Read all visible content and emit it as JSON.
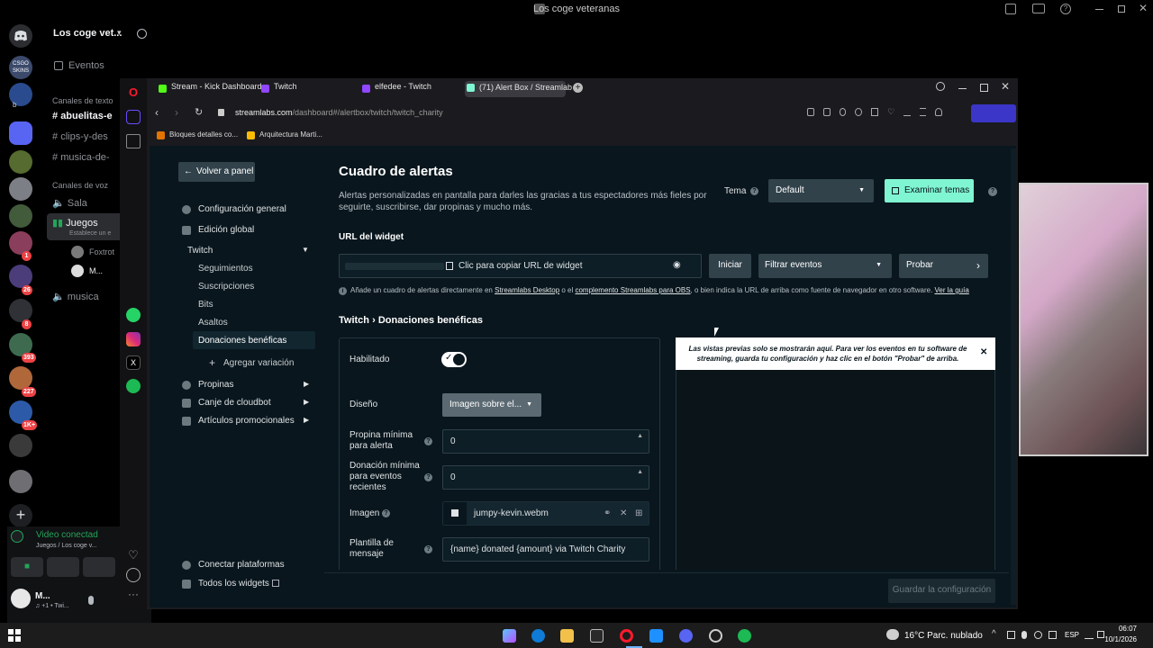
{
  "discord": {
    "window_title": "Los coge veteranas",
    "server_name": "Los coge vet...",
    "events": "Eventos",
    "text_category": "Canales de texto",
    "text_channels": [
      "abuelitas-e",
      "clips-y-des",
      "musica-de-"
    ],
    "voice_category": "Canales de voz",
    "voice_channels": [
      "Sala",
      "Juegos",
      "musica"
    ],
    "juegos_status": "Establece un e",
    "voice_users": [
      "Foxtrot",
      "M..."
    ],
    "server_badges": [
      "1",
      "26",
      "8",
      "393",
      "227",
      "1K+"
    ],
    "server_label_csgo": "CSGO SKINS",
    "server_label_b": "b",
    "voice_connected": "Video conectad",
    "voice_location": "Juegos / Los coge v...",
    "user_name": "M...",
    "user_status": "♫ +1 • Twi..."
  },
  "browser": {
    "tabs": [
      {
        "label": "Stream - Kick Dashboard",
        "color": "#53fc18"
      },
      {
        "label": "Twitch",
        "color": "#9146ff"
      },
      {
        "label": "elfedee - Twitch",
        "color": "#9146ff"
      },
      {
        "label": "(71) Alert Box / Streamlab",
        "color": "#80f5d2"
      }
    ],
    "url_domain": "streamlabs.com",
    "url_path": "/dashboard#/alertbox/twitch/twitch_charity",
    "bookmarks": [
      "Bloques detalles co...",
      "Arquitectura Marti..."
    ]
  },
  "streamlabs": {
    "back_button": "Volver a panel",
    "menu_general": "Configuración general",
    "menu_global": "Edición global",
    "menu_twitch": "Twitch",
    "twitch_items": [
      "Seguimientos",
      "Suscripciones",
      "Bits",
      "Asaltos",
      "Donaciones benéficas"
    ],
    "add_variation": "Agregar variación",
    "menu_tips": "Propinas",
    "menu_cloudbot": "Canje de cloudbot",
    "menu_promo": "Artículos promocionales",
    "connect_platforms": "Conectar plataformas",
    "all_widgets": "Todos los widgets",
    "page_title": "Cuadro de alertas",
    "description": "Alertas personalizadas en pantalla para darles las gracias a tus espectadores más fieles por seguirte, suscribirse, dar propinas y mucho más.",
    "theme_label": "Tema",
    "theme_value": "Default",
    "explore_themes": "Examinar temas",
    "widget_url_label": "URL del widget",
    "copy_url": "Clic para copiar URL de widget",
    "launch": "Iniciar",
    "filter_events": "Filtrar eventos",
    "test": "Probar",
    "info_prefix": "Añade un cuadro de alertas directamente en ",
    "link_desktop": "Streamlabs Desktop",
    "info_mid": " o el ",
    "link_obs": "complemento Streamlabs para OBS",
    "info_suffix": ", o bien indica la URL de arriba como fuente de navegador en otro software. ",
    "link_guide": "Ver la guía",
    "breadcrumb_1": "Twitch",
    "breadcrumb_sep": "›",
    "breadcrumb_2": "Donaciones benéficas",
    "enabled_label": "Habilitado",
    "design_label": "Diseño",
    "design_value": "Imagen sobre el...",
    "min_tip_label": "Propina mínima para alerta",
    "min_tip_value": "0",
    "min_donation_label": "Donación mínima para eventos recientes",
    "min_donation_value": "0",
    "image_label": "Imagen",
    "image_value": "jumpy-kevin.webm",
    "template_label": "Plantilla de mensaje",
    "template_value": "{name} donated {amount} via Twitch Charity",
    "preview_notice": "Las vistas previas solo se mostrarán aquí. Para ver los eventos en tu software de streaming, guarda tu configuración y haz clic en el botón \"Probar\" de arriba.",
    "save_button": "Guardar la configuración"
  },
  "taskbar": {
    "weather": "16°C  Parc. nublado",
    "language": "ESP",
    "time": "06:07",
    "date": "10/1/2026"
  },
  "colors": {
    "accent_green": "#80f5d2",
    "page_bg": "#09161d",
    "discord_green": "#23a55a"
  }
}
